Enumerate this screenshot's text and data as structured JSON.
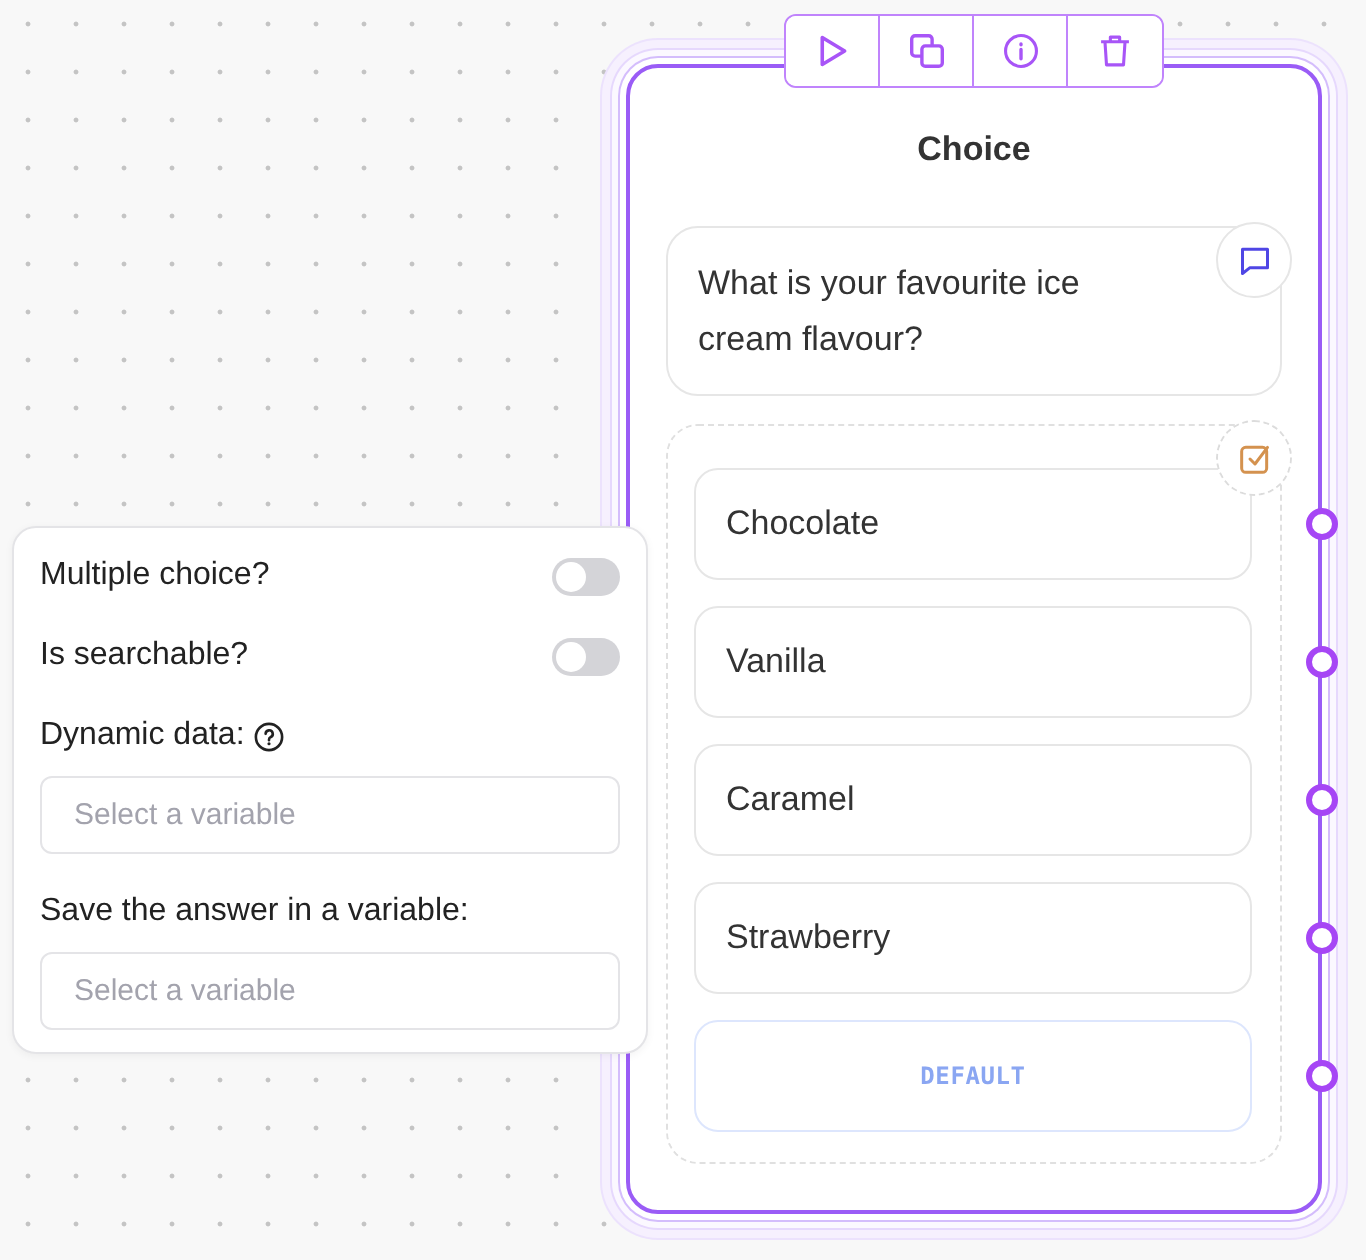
{
  "node": {
    "title": "Choice",
    "message": "What is your favourite ice cream flavour?",
    "choices": [
      {
        "kind": "option",
        "label": "Chocolate"
      },
      {
        "kind": "option",
        "label": "Vanilla"
      },
      {
        "kind": "option",
        "label": "Caramel"
      },
      {
        "kind": "option",
        "label": "Strawberry"
      },
      {
        "kind": "default",
        "label": "DEFAULT"
      }
    ]
  },
  "settings_panel": {
    "toggles": [
      {
        "label": "Multiple choice?",
        "on": false
      },
      {
        "label": "Is searchable?",
        "on": false
      }
    ],
    "fields": [
      {
        "label": "Dynamic data:",
        "help": true,
        "placeholder": "Select a variable"
      },
      {
        "label": "Save the answer in a variable:",
        "help": false,
        "placeholder": "Select a variable"
      }
    ]
  }
}
